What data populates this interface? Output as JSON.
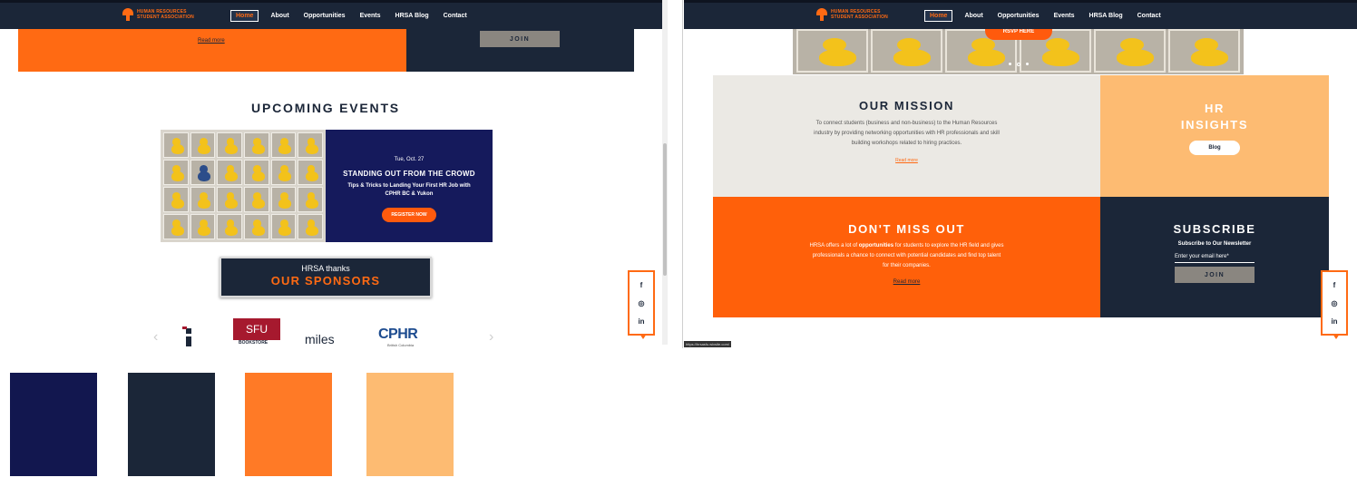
{
  "nav": {
    "logo_line1": "Human Resources",
    "logo_line2": "Student Association",
    "items": [
      "Home",
      "About",
      "Opportunities",
      "Events",
      "HRSA Blog",
      "Contact"
    ]
  },
  "left": {
    "read_more": "Read more",
    "join": "JOIN",
    "upcoming_title": "UPCOMING EVENTS",
    "event": {
      "date": "Tue, Oct. 27",
      "title": "STANDING OUT FROM THE CROWD",
      "subtitle": "Tips & Tricks to Landing Your First HR Job with CPHR BC & Yukon",
      "button": "REGISTER NOW"
    },
    "sponsors_line1": "HRSA thanks",
    "sponsors_line2": "OUR SPONSORS",
    "sponsor_logos": {
      "sfu": "SFU",
      "sfu_sub": "BOOKSTORE",
      "miles": "miles",
      "cphr": "CPHR",
      "cphr_sub": "British Columbia"
    },
    "arrow_prev": "‹",
    "arrow_next": "›"
  },
  "palette": [
    "#12174f",
    "#1b2638",
    "#ff7a26",
    "#fdbb72"
  ],
  "social": {
    "facebook": "f",
    "instagram": "◎",
    "linkedin": "in"
  },
  "right": {
    "rsvp": "RSVP HERE",
    "mission_title": "OUR MISSION",
    "mission_text": "To connect students (business and non-business) to the Human Resources industry by providing networking opportunities with HR professionals and skill building workshops related to hiring practices.",
    "mission_link": "Read more",
    "insights_title_1": "HR",
    "insights_title_2": "INSIGHTS",
    "blog_button": "Blog",
    "dontmiss_title": "DON'T MISS OUT",
    "dontmiss_text_1": "HRSA offers a lot of",
    "dontmiss_text_bold": "opportunities",
    "dontmiss_text_2": "for students to explore the HR field and gives professionals a chance to connect with potential candidates and find top talent for their companies.",
    "dontmiss_link": "Read more",
    "subscribe_title": "SUBSCRIBE",
    "subscribe_sub": "Subscribe to Our Newsletter",
    "email_placeholder": "Enter your email here*",
    "join": "JOIN",
    "status_url": "https://hrsasfu.wixsite.com/"
  }
}
